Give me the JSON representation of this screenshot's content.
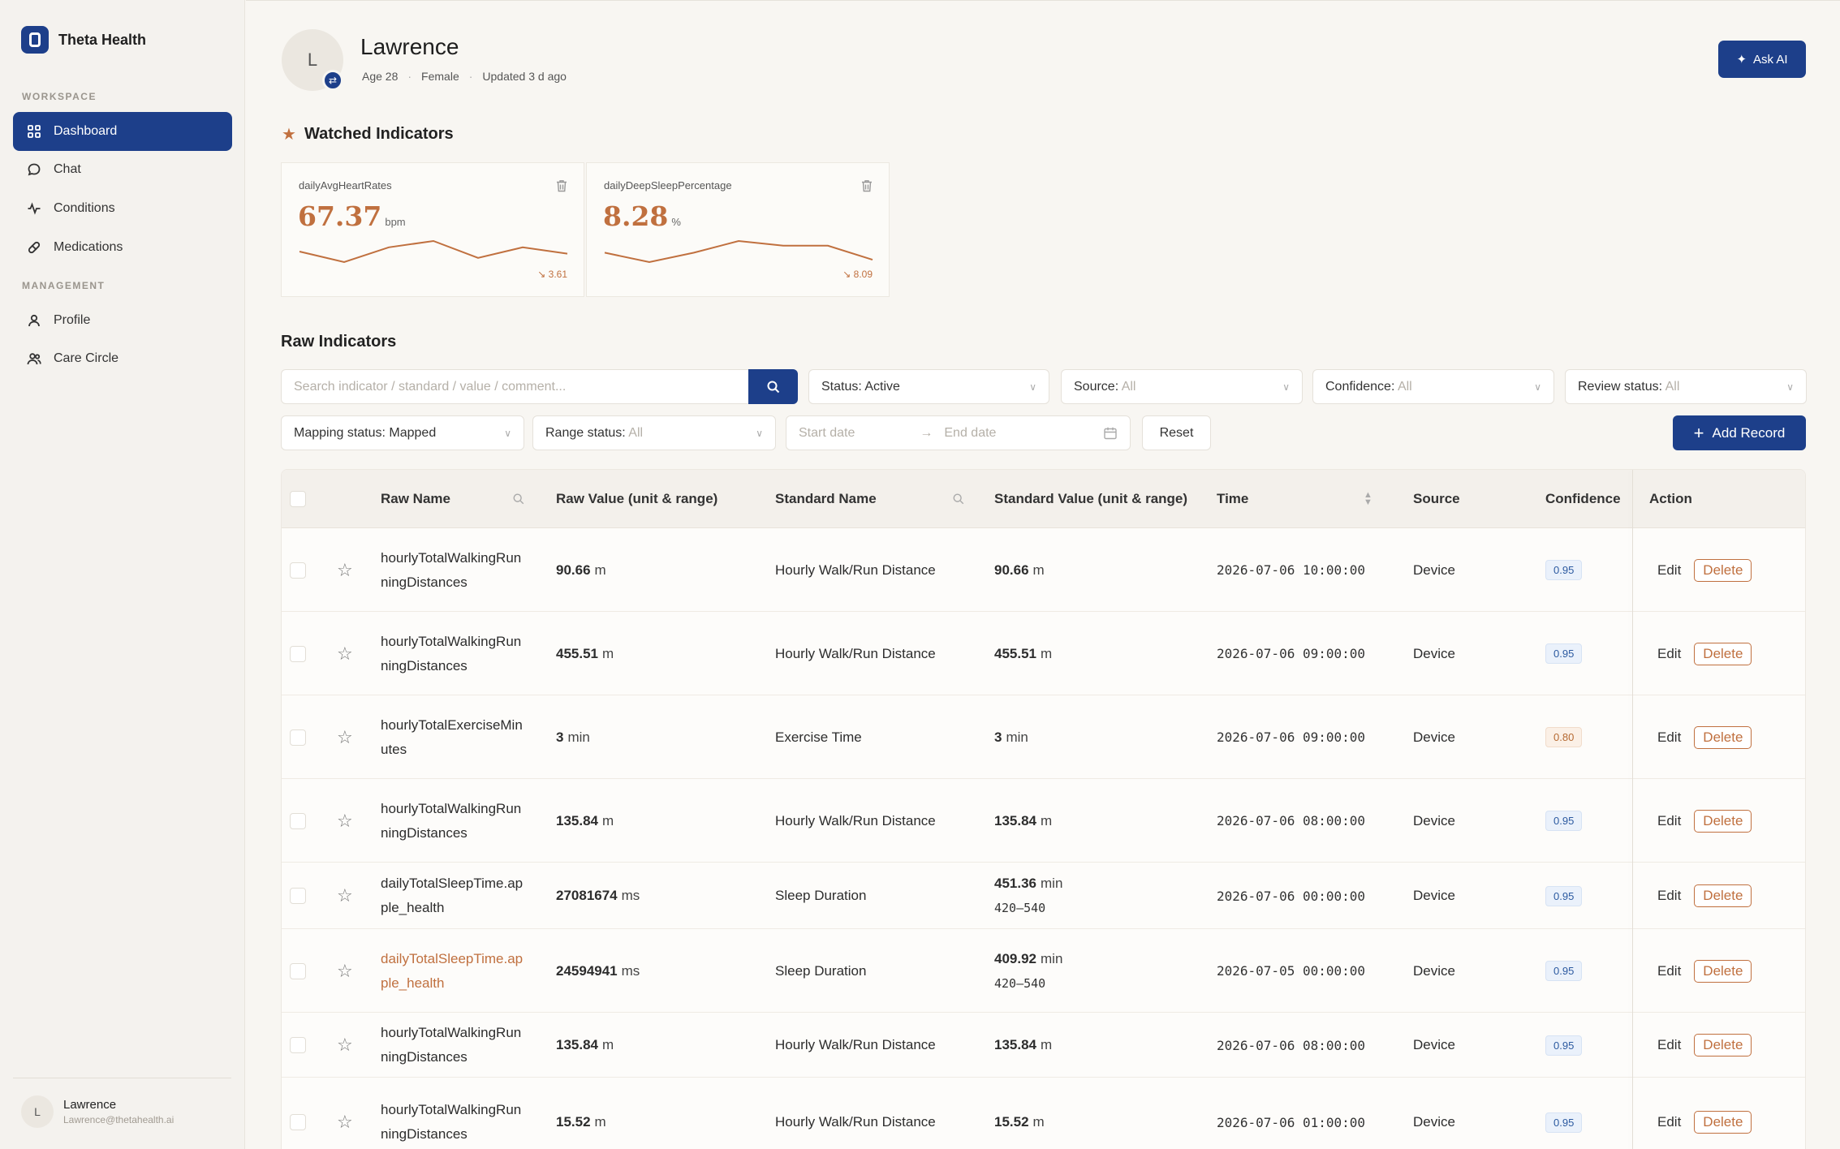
{
  "brand": {
    "name": "Theta Health"
  },
  "sidebar": {
    "workspace_label": "WORKSPACE",
    "management_label": "MANAGEMENT",
    "workspace_items": [
      {
        "label": "Dashboard",
        "icon": "grid-icon",
        "active": true
      },
      {
        "label": "Chat",
        "icon": "chat-icon"
      },
      {
        "label": "Conditions",
        "icon": "pulse-icon"
      },
      {
        "label": "Medications",
        "icon": "pill-icon"
      }
    ],
    "management_items": [
      {
        "label": "Profile",
        "icon": "user-icon"
      },
      {
        "label": "Care Circle",
        "icon": "users-icon"
      }
    ],
    "user": {
      "initial": "L",
      "name": "Lawrence",
      "email": "Lawrence@thetahealth.ai"
    }
  },
  "profile": {
    "initial": "L",
    "name": "Lawrence",
    "age": "Age 28",
    "gender": "Female",
    "updated": "Updated 3 d ago",
    "separator": "·"
  },
  "ask_ai": {
    "label": "Ask AI"
  },
  "watched": {
    "title": "Watched Indicators",
    "cards": [
      {
        "name": "dailyAvgHeartRates",
        "value": "67.37",
        "unit": "bpm",
        "delta": "↘ 3.61",
        "trend": [
          50,
          45,
          52,
          55,
          47,
          52,
          49
        ]
      },
      {
        "name": "dailyDeepSleepPercentage",
        "value": "8.28",
        "unit": "%",
        "delta": "↘ 8.09",
        "trend": [
          49,
          45,
          49,
          54,
          52,
          52,
          46
        ]
      }
    ]
  },
  "raw": {
    "title": "Raw Indicators",
    "search_placeholder": "Search indicator / standard / value / comment...",
    "filters": {
      "status": {
        "label": "Status:",
        "value": "Active"
      },
      "source": {
        "label": "Source:",
        "value": "All"
      },
      "confidence": {
        "label": "Confidence:",
        "value": "All"
      },
      "review": {
        "label": "Review status:",
        "value": "All"
      },
      "mapping": {
        "label": "Mapping status:",
        "value": "Mapped"
      },
      "range": {
        "label": "Range status:",
        "value": "All"
      },
      "start_date": "Start date",
      "end_date": "End date"
    },
    "reset_label": "Reset",
    "add_label": "Add Record",
    "columns": {
      "raw_name": "Raw Name",
      "raw_value": "Raw Value (unit & range)",
      "standard_name": "Standard Name",
      "standard_value": "Standard Value (unit & range)",
      "time": "Time",
      "source": "Source",
      "confidence": "Confidence",
      "action": "Action"
    },
    "edit_label": "Edit",
    "delete_label": "Delete",
    "rows": [
      {
        "raw_name": "hourlyTotalWalkingRunningDistances",
        "raw_value": "90.66",
        "raw_unit": "m",
        "standard_name": "Hourly Walk/Run Distance",
        "std_value": "90.66",
        "std_unit": "m",
        "std_range": "",
        "time": "2026-07-06 10:00:00",
        "source": "Device",
        "confidence": "0.95",
        "level": "hi"
      },
      {
        "raw_name": "hourlyTotalWalkingRunningDistances",
        "raw_value": "455.51",
        "raw_unit": "m",
        "standard_name": "Hourly Walk/Run Distance",
        "std_value": "455.51",
        "std_unit": "m",
        "std_range": "",
        "time": "2026-07-06 09:00:00",
        "source": "Device",
        "confidence": "0.95",
        "level": "hi"
      },
      {
        "raw_name": "hourlyTotalExerciseMinutes",
        "raw_value": "3",
        "raw_unit": "min",
        "standard_name": "Exercise Time",
        "std_value": "3",
        "std_unit": "min",
        "std_range": "",
        "time": "2026-07-06 09:00:00",
        "source": "Device",
        "confidence": "0.80",
        "level": "mid"
      },
      {
        "raw_name": "hourlyTotalWalkingRunningDistances",
        "raw_value": "135.84",
        "raw_unit": "m",
        "standard_name": "Hourly Walk/Run Distance",
        "std_value": "135.84",
        "std_unit": "m",
        "std_range": "",
        "time": "2026-07-06 08:00:00",
        "source": "Device",
        "confidence": "0.95",
        "level": "hi"
      },
      {
        "raw_name": "dailyTotalSleepTime.apple_health",
        "raw_value": "27081674",
        "raw_unit": "ms",
        "standard_name": "Sleep Duration",
        "std_value": "451.36",
        "std_unit": "min",
        "std_range": "420–540",
        "time": "2026-07-06 00:00:00",
        "source": "Device",
        "confidence": "0.95",
        "level": "hi"
      },
      {
        "raw_name": "dailyTotalSleepTime.apple_health",
        "raw_value": "24594941",
        "raw_unit": "ms",
        "standard_name": "Sleep Duration",
        "std_value": "409.92",
        "std_unit": "min",
        "std_range": "420–540",
        "time": "2026-07-05 00:00:00",
        "source": "Device",
        "confidence": "0.95",
        "level": "hi",
        "highlight": true
      },
      {
        "raw_name": "hourlyTotalWalkingRunningDistances",
        "raw_value": "135.84",
        "raw_unit": "m",
        "standard_name": "Hourly Walk/Run Distance",
        "std_value": "135.84",
        "std_unit": "m",
        "std_range": "",
        "time": "2026-07-06 08:00:00",
        "source": "Device",
        "confidence": "0.95",
        "level": "hi"
      },
      {
        "raw_name": "hourlyTotalWalkingRunningDistances",
        "raw_value": "15.52",
        "raw_unit": "m",
        "standard_name": "Hourly Walk/Run Distance",
        "std_value": "15.52",
        "std_unit": "m",
        "std_range": "",
        "time": "2026-07-06 01:00:00",
        "source": "Device",
        "confidence": "0.95",
        "level": "hi"
      }
    ]
  },
  "colors": {
    "primary": "#1d3f8a",
    "accent": "#c0703f"
  }
}
